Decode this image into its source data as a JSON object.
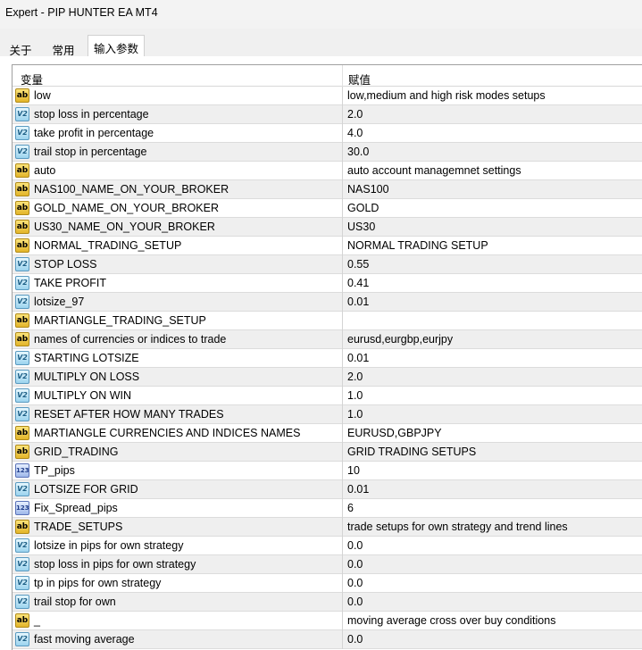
{
  "window": {
    "title": "Expert - PIP HUNTER EA MT4"
  },
  "tabs": [
    {
      "label": "关于",
      "active": false
    },
    {
      "label": "常用",
      "active": false
    },
    {
      "label": "输入参数",
      "active": true
    }
  ],
  "table": {
    "columns": {
      "variable": "变量",
      "value": "赋值"
    },
    "rows": [
      {
        "icon": "ab",
        "name": "low",
        "value": "low,medium and high risk modes setups"
      },
      {
        "icon": "v2",
        "name": "stop loss in percentage",
        "value": "2.0"
      },
      {
        "icon": "v2",
        "name": "take profit in percentage",
        "value": "4.0"
      },
      {
        "icon": "v2",
        "name": "trail stop in percentage",
        "value": "30.0"
      },
      {
        "icon": "ab",
        "name": "auto",
        "value": "auto account managemnet settings"
      },
      {
        "icon": "ab",
        "name": "NAS100_NAME_ON_YOUR_BROKER",
        "value": "NAS100"
      },
      {
        "icon": "ab",
        "name": "GOLD_NAME_ON_YOUR_BROKER",
        "value": "GOLD"
      },
      {
        "icon": "ab",
        "name": "US30_NAME_ON_YOUR_BROKER",
        "value": "US30"
      },
      {
        "icon": "ab",
        "name": "NORMAL_TRADING_SETUP",
        "value": "NORMAL TRADING SETUP"
      },
      {
        "icon": "v2",
        "name": "STOP LOSS",
        "value": "0.55"
      },
      {
        "icon": "v2",
        "name": "TAKE PROFIT",
        "value": "0.41"
      },
      {
        "icon": "v2",
        "name": "lotsize_97",
        "value": "0.01"
      },
      {
        "icon": "ab",
        "name": "MARTIANGLE_TRADING_SETUP",
        "value": ""
      },
      {
        "icon": "ab",
        "name": "names of currencies or indices to trade",
        "value": "eurusd,eurgbp,eurjpy"
      },
      {
        "icon": "v2",
        "name": "STARTING LOTSIZE",
        "value": "0.01"
      },
      {
        "icon": "v2",
        "name": "MULTIPLY ON LOSS",
        "value": "2.0"
      },
      {
        "icon": "v2",
        "name": "MULTIPLY ON WIN",
        "value": "1.0"
      },
      {
        "icon": "v2",
        "name": "RESET AFTER HOW MANY TRADES",
        "value": "1.0"
      },
      {
        "icon": "ab",
        "name": "MARTIANGLE CURRENCIES AND INDICES NAMES",
        "value": "EURUSD,GBPJPY"
      },
      {
        "icon": "ab",
        "name": "GRID_TRADING",
        "value": "GRID TRADING SETUPS"
      },
      {
        "icon": "n123",
        "name": "TP_pips",
        "value": "10"
      },
      {
        "icon": "v2",
        "name": "LOTSIZE FOR GRID",
        "value": "0.01"
      },
      {
        "icon": "n123",
        "name": "Fix_Spread_pips",
        "value": "6"
      },
      {
        "icon": "ab",
        "name": "TRADE_SETUPS",
        "value": "trade setups for own strategy and trend lines"
      },
      {
        "icon": "v2",
        "name": "lotsize in pips for own strategy",
        "value": "0.0"
      },
      {
        "icon": "v2",
        "name": "stop loss in pips for own strategy",
        "value": "0.0"
      },
      {
        "icon": "v2",
        "name": "tp in pips for own strategy",
        "value": "0.0"
      },
      {
        "icon": "v2",
        "name": "trail stop for own",
        "value": "0.0"
      },
      {
        "icon": "ab",
        "name": "_",
        "value": "moving average cross over buy conditions"
      },
      {
        "icon": "v2",
        "name": "fast moving average",
        "value": "0.0"
      }
    ]
  },
  "icon_glyphs": {
    "ab": "ab",
    "v2": "V2",
    "n123": "123"
  }
}
